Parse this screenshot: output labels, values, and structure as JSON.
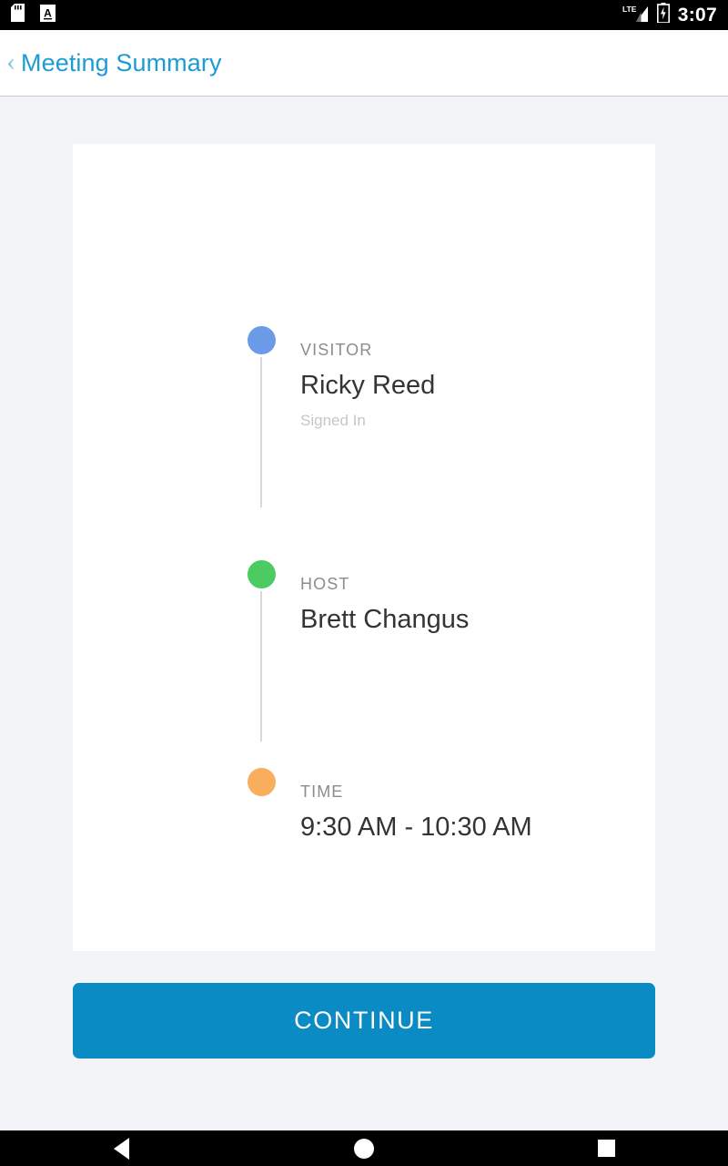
{
  "status_bar": {
    "icons_left": [
      "sd-card-icon",
      "app-notification-a-icon"
    ],
    "network_label": "LTE",
    "icons_right": [
      "lte-signal-icon",
      "battery-charging-icon"
    ],
    "clock": "3:07"
  },
  "app_bar": {
    "back_icon": "back-chevron-icon",
    "back_glyph": "‹",
    "title": "Meeting Summary",
    "title_color": "#1c9cd2",
    "chevron_color": "#84c9e6"
  },
  "card": {
    "ghost_text": "",
    "timeline": [
      {
        "id": "visitor",
        "label": "VISITOR",
        "value": "Ricky Reed",
        "sub": "Signed In",
        "dot_color": "#6b9be8"
      },
      {
        "id": "host",
        "label": "HOST",
        "value": "Brett Changus",
        "sub": "",
        "dot_color": "#4ccb63"
      },
      {
        "id": "time",
        "label": "TIME",
        "value": "9:30 AM - 10:30 AM",
        "sub": "",
        "dot_color": "#f9ae5e"
      }
    ]
  },
  "continue_button": {
    "label": "CONTINUE",
    "background": "#0b8bc4",
    "text_color": "#ffffff"
  },
  "nav_bar": {
    "back_icon": "nav-back-triangle-icon",
    "home_icon": "nav-home-circle-icon",
    "recents_icon": "nav-recents-square-icon"
  },
  "colors": {
    "page_background": "#f2f4f7",
    "card_background": "#ffffff",
    "label_gray": "#8c8c8c",
    "value_dark": "#333436",
    "sub_gray": "#c6c6c6",
    "timeline_line": "#d9d9d9"
  }
}
